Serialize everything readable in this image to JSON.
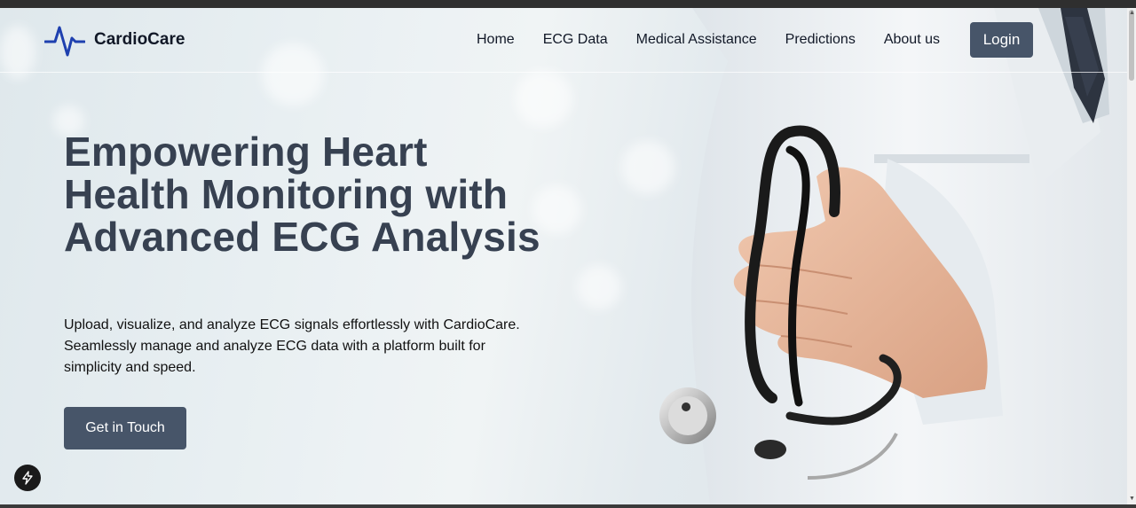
{
  "brand": {
    "name": "CardioCare",
    "logo_icon": "heartbeat-pulse-icon",
    "color": "#1e40af"
  },
  "nav": {
    "items": [
      {
        "label": "Home"
      },
      {
        "label": "ECG Data"
      },
      {
        "label": "Medical Assistance"
      },
      {
        "label": "Predictions"
      },
      {
        "label": "About us"
      }
    ],
    "login_label": "Login"
  },
  "hero": {
    "title": "Empowering Heart Health Monitoring with Advanced ECG Analysis",
    "description": "Upload, visualize, and analyze ECG signals effortlessly with CardioCare. Seamlessly manage and analyze ECG data with a platform built for simplicity and speed.",
    "cta_label": "Get in Touch",
    "image": "doctor-with-stethoscope-photo"
  },
  "theme": {
    "button_color": "#475569",
    "heading_color": "#374151"
  },
  "floating_button": {
    "icon": "lightning-bolt-icon"
  }
}
